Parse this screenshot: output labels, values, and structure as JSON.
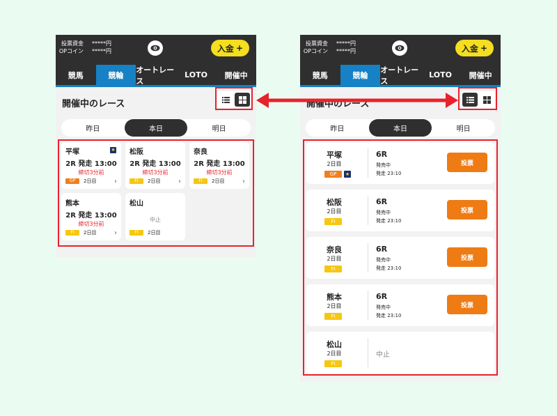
{
  "colors": {
    "background": "#eafbf2",
    "header": "#2f2f2f",
    "accent_blue": "#1681c4",
    "deposit_yellow": "#f5de1f",
    "highlight_red": "#e8222b",
    "vote_orange": "#ee7b14",
    "gp_orange": "#f07f1f",
    "fi_yellow": "#f5c712"
  },
  "header": {
    "balance_label": "投票資金",
    "balance_value": "*****円",
    "coin_label": "OPコイン",
    "coin_value": "*****円",
    "eye_icon": "eye-icon",
    "deposit_label": "入金",
    "deposit_plus": "+"
  },
  "nav": {
    "tabs": [
      "競馬",
      "競輪",
      "オートレース",
      "LOTO",
      "開催中"
    ],
    "active_index": 1
  },
  "section": {
    "title": "開催中のレース"
  },
  "view_toggle": {
    "list_icon": "list-view-icon",
    "grid_icon": "grid-view-icon"
  },
  "days": {
    "tabs": [
      "昨日",
      "本日",
      "明日"
    ],
    "selected_index": 1
  },
  "grid_races": [
    {
      "venue": "平塚",
      "race": "2R 発走 13:00",
      "close": "締切3分前",
      "grade": "GP",
      "day": "2日目",
      "star": "★",
      "chevron": "›"
    },
    {
      "venue": "松阪",
      "race": "2R 発走 13:00",
      "close": "締切3分前",
      "grade": "FⅠ",
      "day": "2日目",
      "chevron": "›"
    },
    {
      "venue": "奈良",
      "race": "2R 発走 13:00",
      "close": "締切3分前",
      "grade": "FⅠ",
      "day": "2日目",
      "chevron": "›"
    },
    {
      "venue": "熊本",
      "race": "2R 発走 13:00",
      "close": "締切3分前",
      "grade": "FⅠ",
      "day": "2日目",
      "chevron": "›"
    },
    {
      "venue": "松山",
      "cancel": "中止",
      "grade": "FⅠ",
      "day": "2日目"
    }
  ],
  "list_races": [
    {
      "venue": "平塚",
      "day": "2日目",
      "grade": "GP",
      "star": "★",
      "race": "6R",
      "status": "発売中",
      "start": "発走 23:10",
      "vote": "投票"
    },
    {
      "venue": "松阪",
      "day": "2日目",
      "grade": "FⅠ",
      "race": "6R",
      "status": "発売中",
      "start": "発走 23:10",
      "vote": "投票"
    },
    {
      "venue": "奈良",
      "day": "2日目",
      "grade": "FⅠ",
      "race": "6R",
      "status": "発売中",
      "start": "発走 23:10",
      "vote": "投票"
    },
    {
      "venue": "熊本",
      "day": "2日目",
      "grade": "FⅠ",
      "race": "6R",
      "status": "発売中",
      "start": "発走 23:10",
      "vote": "投票"
    },
    {
      "venue": "松山",
      "day": "2日目",
      "grade": "FⅠ",
      "cancel": "中止"
    }
  ]
}
